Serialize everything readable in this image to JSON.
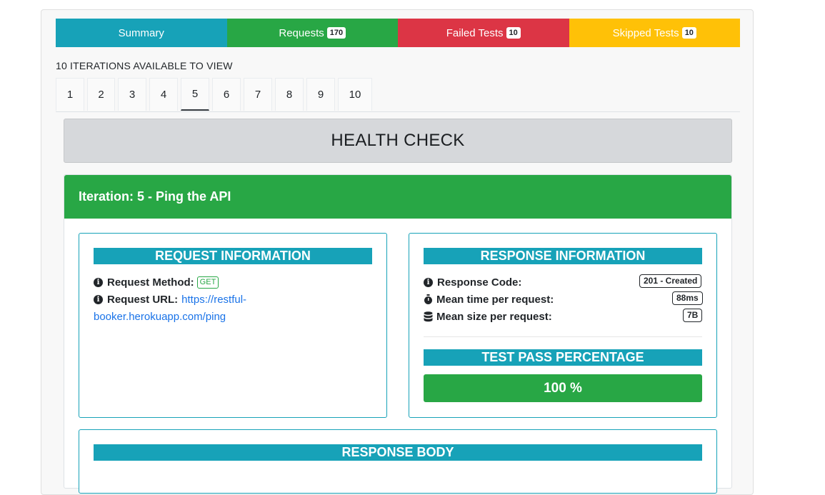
{
  "summary_tabs": [
    {
      "label": "Summary",
      "count": ""
    },
    {
      "label": "Requests",
      "count": "170"
    },
    {
      "label": "Failed Tests",
      "count": "10"
    },
    {
      "label": "Skipped Tests",
      "count": "10"
    }
  ],
  "iterations": {
    "heading": "10 ITERATIONS AVAILABLE TO VIEW",
    "tabs": [
      "1",
      "2",
      "3",
      "4",
      "5",
      "6",
      "7",
      "8",
      "9",
      "10"
    ],
    "active": "5"
  },
  "folder_title": "HEALTH CHECK",
  "iteration_card": {
    "header": "Iteration: 5 - Ping the API"
  },
  "request_info": {
    "title": "REQUEST INFORMATION",
    "method_label": "Request Method:",
    "method_value": "GET",
    "url_label": "Request URL:",
    "url_line1": "https://restful-",
    "url_line2": "booker.herokuapp.com/ping"
  },
  "response_info": {
    "title": "RESPONSE INFORMATION",
    "code_label": "Response Code:",
    "code_value": "201 - Created",
    "time_label": "Mean time per request:",
    "time_value": "88ms",
    "size_label": "Mean size per request:",
    "size_value": "7B"
  },
  "test_pass": {
    "title": "TEST PASS PERCENTAGE",
    "value": "100 %",
    "fraction": 1.0
  },
  "response_body": {
    "title": "RESPONSE BODY"
  },
  "colors": {
    "info": "#17a2b8",
    "success": "#28a745",
    "danger": "#dc3545",
    "warning": "#ffc107"
  }
}
